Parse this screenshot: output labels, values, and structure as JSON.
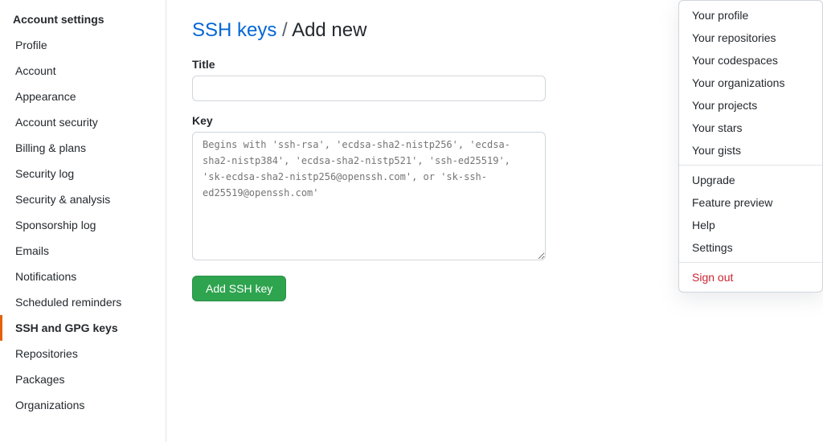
{
  "sidebar": {
    "title": "Account settings",
    "items": [
      {
        "label": "Profile",
        "id": "profile",
        "active": false
      },
      {
        "label": "Account",
        "id": "account",
        "active": false
      },
      {
        "label": "Appearance",
        "id": "appearance",
        "active": false
      },
      {
        "label": "Account security",
        "id": "account-security",
        "active": false
      },
      {
        "label": "Billing & plans",
        "id": "billing",
        "active": false
      },
      {
        "label": "Security log",
        "id": "security-log",
        "active": false
      },
      {
        "label": "Security & analysis",
        "id": "security-analysis",
        "active": false
      },
      {
        "label": "Sponsorship log",
        "id": "sponsorship-log",
        "active": false
      },
      {
        "label": "Emails",
        "id": "emails",
        "active": false
      },
      {
        "label": "Notifications",
        "id": "notifications",
        "active": false
      },
      {
        "label": "Scheduled reminders",
        "id": "scheduled-reminders",
        "active": false
      },
      {
        "label": "SSH and GPG keys",
        "id": "ssh-gpg",
        "active": true
      },
      {
        "label": "Repositories",
        "id": "repositories",
        "active": false
      },
      {
        "label": "Packages",
        "id": "packages",
        "active": false
      },
      {
        "label": "Organizations",
        "id": "organizations",
        "active": false
      }
    ]
  },
  "main": {
    "breadcrumb_link": "SSH keys",
    "breadcrumb_separator": "/",
    "breadcrumb_current": "Add new",
    "title_label": "Title",
    "title_placeholder": "",
    "key_label": "Key",
    "key_placeholder": "Begins with 'ssh-rsa', 'ecdsa-sha2-nistp256', 'ecdsa-sha2-nistp384', 'ecdsa-sha2-nistp521', 'ssh-ed25519', 'sk-ecdsa-sha2-nistp256@openssh.com', or 'sk-ssh-ed25519@openssh.com'",
    "add_button_label": "Add SSH key"
  },
  "dropdown": {
    "sections": [
      {
        "items": [
          {
            "label": "Your profile",
            "id": "your-profile"
          },
          {
            "label": "Your repositories",
            "id": "your-repos"
          },
          {
            "label": "Your codespaces",
            "id": "your-codespaces"
          },
          {
            "label": "Your organizations",
            "id": "your-orgs"
          },
          {
            "label": "Your projects",
            "id": "your-projects"
          },
          {
            "label": "Your stars",
            "id": "your-stars"
          },
          {
            "label": "Your gists",
            "id": "your-gists"
          }
        ]
      },
      {
        "items": [
          {
            "label": "Upgrade",
            "id": "upgrade"
          },
          {
            "label": "Feature preview",
            "id": "feature-preview"
          },
          {
            "label": "Help",
            "id": "help"
          },
          {
            "label": "Settings",
            "id": "settings"
          }
        ]
      },
      {
        "items": [
          {
            "label": "Sign out",
            "id": "sign-out",
            "danger": true
          }
        ]
      }
    ]
  }
}
